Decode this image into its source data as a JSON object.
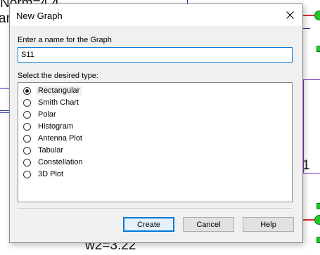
{
  "background": {
    "text_top": "Norm=4.4",
    "text_left": "am",
    "text_right": "1",
    "text_bottom": "w2=3.22",
    "colors": {
      "wire": "#1f2db8",
      "port": "#22c52a",
      "component": "#7b2fbe",
      "marker": "#e2262c"
    }
  },
  "dialog": {
    "title": "New Graph",
    "close_icon": "close-icon",
    "name_label": "Enter a name for the Graph",
    "name_value": "S11",
    "type_label": "Select the desired type:",
    "types": [
      {
        "label": "Rectangular",
        "selected": true
      },
      {
        "label": "Smith Chart",
        "selected": false
      },
      {
        "label": "Polar",
        "selected": false
      },
      {
        "label": "Histogram",
        "selected": false
      },
      {
        "label": "Antenna Plot",
        "selected": false
      },
      {
        "label": "Tabular",
        "selected": false
      },
      {
        "label": "Constellation",
        "selected": false
      },
      {
        "label": "3D Plot",
        "selected": false
      }
    ],
    "buttons": {
      "create": "Create",
      "cancel": "Cancel",
      "help": "Help"
    }
  }
}
